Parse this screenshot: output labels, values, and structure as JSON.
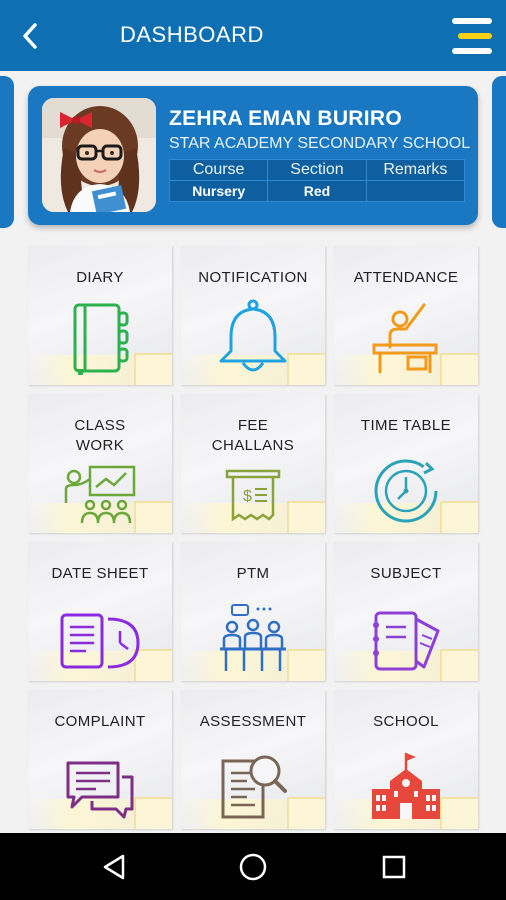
{
  "header": {
    "title": "DASHBOARD",
    "back_icon": "back-chevron-icon",
    "menu_icon": "hamburger-menu-icon",
    "colors": {
      "bar": "#0f6fb3",
      "menu_white": "#ffffff",
      "menu_yellow": "#f7d117"
    }
  },
  "profile": {
    "name": "ZEHRA EMAN BURIRO",
    "school": "STAR ACADEMY SECONDARY SCHOOL",
    "table": {
      "headers": [
        "Course",
        "Section",
        "Remarks"
      ],
      "values": [
        "Nursery",
        "Red",
        ""
      ]
    }
  },
  "tiles": [
    {
      "label": "DIARY",
      "icon": "diary-icon",
      "color": "#2bb24c"
    },
    {
      "label": "NOTIFICATION",
      "icon": "bell-icon",
      "color": "#1fa3e0"
    },
    {
      "label": "ATTENDANCE",
      "icon": "attendance-icon",
      "color": "#f39a1a"
    },
    {
      "label": "CLASS\nWORK",
      "icon": "classwork-icon",
      "color": "#6aa83a"
    },
    {
      "label": "FEE\nCHALLANS",
      "icon": "fee-challan-icon",
      "color": "#8aa23a"
    },
    {
      "label": "TIME TABLE",
      "icon": "clock-icon",
      "color": "#2aa3b8"
    },
    {
      "label": "DATE SHEET",
      "icon": "datesheet-icon",
      "color": "#8a2be2"
    },
    {
      "label": "PTM",
      "icon": "meeting-icon",
      "color": "#2f6fc4"
    },
    {
      "label": "SUBJECT",
      "icon": "subject-notebook-icon",
      "color": "#8e3fd6"
    },
    {
      "label": "COMPLAINT",
      "icon": "complaint-chat-icon",
      "color": "#7d2f86"
    },
    {
      "label": "ASSESSMENT",
      "icon": "assessment-search-icon",
      "color": "#7a6655"
    },
    {
      "label": "SCHOOL",
      "icon": "school-building-icon",
      "color": "#e8473b"
    }
  ],
  "navbar": {
    "back_icon": "nav-back-triangle-icon",
    "home_icon": "nav-home-circle-icon",
    "recents_icon": "nav-recents-square-icon"
  }
}
